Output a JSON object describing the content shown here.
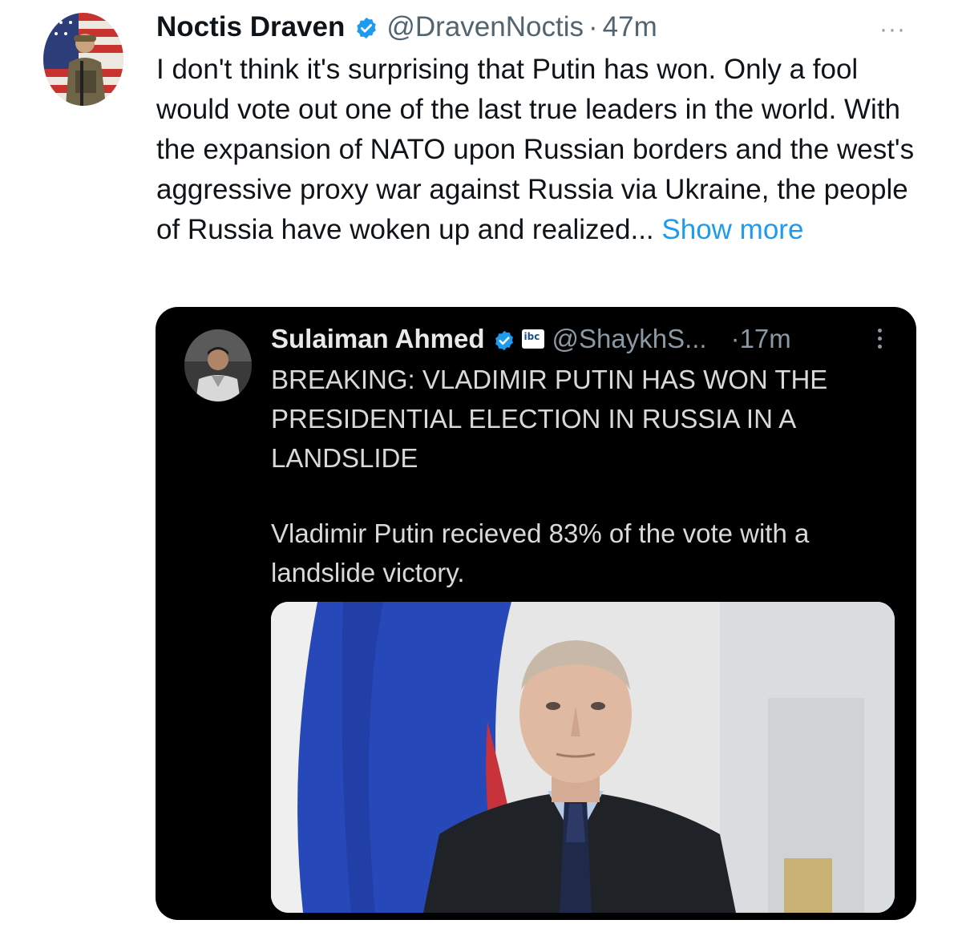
{
  "tweet": {
    "author_name": "Noctis Draven",
    "handle": "@DravenNoctis",
    "separator": "·",
    "time": "47m",
    "more_icon": "···",
    "text": "I don't think it's surprising that Putin has won. Only a fool would vote out one of the last true leaders in the world. With the expansion of NATO upon Russian borders and the west's aggressive proxy war against Russia via Ukraine, the people of Russia have woken up and realized...",
    "show_more": "Show more"
  },
  "quote": {
    "author_name": "Sulaiman Ahmed",
    "affiliation_badge": "ibc",
    "handle": "@ShaykhS...",
    "time": "·17m",
    "headline": "BREAKING: VLADIMIR PUTIN HAS WON THE PRESIDENTIAL ELECTION IN RUSSIA IN A LANDSLIDE",
    "body": "Vladimir Putin recieved 83% of the vote with a landslide victory."
  },
  "colors": {
    "verified": "#1d9bf0",
    "link": "#1d9bf0",
    "quote_background": "#000000"
  },
  "icons": {
    "verified": "verified-badge-icon",
    "more": "more-horizontal-icon",
    "quote_menu": "more-vertical-icon"
  }
}
